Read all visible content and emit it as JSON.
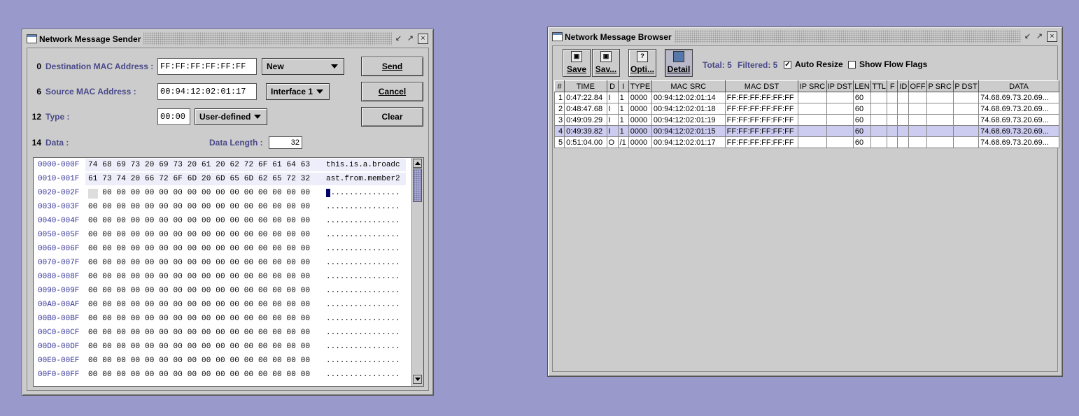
{
  "sender": {
    "title": "Network Message Sender",
    "fields": [
      {
        "num": "0",
        "label": "Destination MAC Address :",
        "value": "FF:FF:FF:FF:FF:FF",
        "combo": "New"
      },
      {
        "num": "6",
        "label": "Source MAC Address :",
        "value": "00:94:12:02:01:17",
        "combo": "Interface 1"
      },
      {
        "num": "12",
        "label": "Type :",
        "value": "00:00",
        "combo": "User-defined"
      }
    ],
    "data_num": "14",
    "data_label": "Data :",
    "data_length_label": "Data Length :",
    "data_length_value": "32",
    "buttons": {
      "send": "Send",
      "cancel": "Cancel",
      "clear": "Clear"
    },
    "hex_rows": [
      {
        "offset": "0000-000F",
        "bytes": "74 68 69 73 20 69 73 20 61 20 62 72 6F 61 64 63",
        "ascii": "this.is.a.broadc"
      },
      {
        "offset": "0010-001F",
        "bytes": "61 73 74 20 66 72 6F 6D 20 6D 65 6D 62 65 72 32",
        "ascii": "ast.from.member2"
      },
      {
        "offset": "0020-002F",
        "bytes": "00 00 00 00 00 00 00 00 00 00 00 00 00 00 00 00",
        "ascii": "................"
      },
      {
        "offset": "0030-003F",
        "bytes": "00 00 00 00 00 00 00 00 00 00 00 00 00 00 00 00",
        "ascii": "................"
      },
      {
        "offset": "0040-004F",
        "bytes": "00 00 00 00 00 00 00 00 00 00 00 00 00 00 00 00",
        "ascii": "................"
      },
      {
        "offset": "0050-005F",
        "bytes": "00 00 00 00 00 00 00 00 00 00 00 00 00 00 00 00",
        "ascii": "................"
      },
      {
        "offset": "0060-006F",
        "bytes": "00 00 00 00 00 00 00 00 00 00 00 00 00 00 00 00",
        "ascii": "................"
      },
      {
        "offset": "0070-007F",
        "bytes": "00 00 00 00 00 00 00 00 00 00 00 00 00 00 00 00",
        "ascii": "................"
      },
      {
        "offset": "0080-008F",
        "bytes": "00 00 00 00 00 00 00 00 00 00 00 00 00 00 00 00",
        "ascii": "................"
      },
      {
        "offset": "0090-009F",
        "bytes": "00 00 00 00 00 00 00 00 00 00 00 00 00 00 00 00",
        "ascii": "................"
      },
      {
        "offset": "00A0-00AF",
        "bytes": "00 00 00 00 00 00 00 00 00 00 00 00 00 00 00 00",
        "ascii": "................"
      },
      {
        "offset": "00B0-00BF",
        "bytes": "00 00 00 00 00 00 00 00 00 00 00 00 00 00 00 00",
        "ascii": "................"
      },
      {
        "offset": "00C0-00CF",
        "bytes": "00 00 00 00 00 00 00 00 00 00 00 00 00 00 00 00",
        "ascii": "................"
      },
      {
        "offset": "00D0-00DF",
        "bytes": "00 00 00 00 00 00 00 00 00 00 00 00 00 00 00 00",
        "ascii": "................"
      },
      {
        "offset": "00E0-00EF",
        "bytes": "00 00 00 00 00 00 00 00 00 00 00 00 00 00 00 00",
        "ascii": "................"
      },
      {
        "offset": "00F0-00FF",
        "bytes": "00 00 00 00 00 00 00 00 00 00 00 00 00 00 00 00",
        "ascii": "................"
      }
    ]
  },
  "browser": {
    "title": "Network Message Browser",
    "toolbar": [
      {
        "label": "Save",
        "icon": "save-icon"
      },
      {
        "label": "Sav...",
        "icon": "save-as-icon"
      },
      {
        "label": "Opti...",
        "icon": "options-icon"
      },
      {
        "label": "Detail",
        "icon": "detail-icon"
      }
    ],
    "total_text": "Total: 5",
    "filtered_text": "Filtered: 5",
    "auto_resize": {
      "label": "Auto Resize",
      "checked": true
    },
    "show_flow_flags": {
      "label": "Show Flow Flags",
      "checked": false
    },
    "columns": [
      "#",
      "TIME",
      "D",
      "I",
      "TYPE",
      "MAC SRC",
      "MAC DST",
      "IP SRC",
      "IP DST",
      "LEN",
      "TTL",
      "F",
      "ID",
      "OFF",
      "P SRC",
      "P DST",
      "DATA"
    ],
    "rows": [
      [
        "1",
        "0:47:22.84",
        "I",
        "1",
        "0000",
        "00:94:12:02:01:14",
        "FF:FF:FF:FF:FF:FF",
        "",
        "",
        "60",
        "",
        "",
        "",
        "",
        "",
        "",
        "74.68.69.73.20.69..."
      ],
      [
        "2",
        "0:48:47.68",
        "I",
        "1",
        "0000",
        "00:94:12:02:01:18",
        "FF:FF:FF:FF:FF:FF",
        "",
        "",
        "60",
        "",
        "",
        "",
        "",
        "",
        "",
        "74.68.69.73.20.69..."
      ],
      [
        "3",
        "0:49:09.29",
        "I",
        "1",
        "0000",
        "00:94:12:02:01:19",
        "FF:FF:FF:FF:FF:FF",
        "",
        "",
        "60",
        "",
        "",
        "",
        "",
        "",
        "",
        "74.68.69.73.20.69..."
      ],
      [
        "4",
        "0:49:39.82",
        "I",
        "1",
        "0000",
        "00:94:12:02:01:15",
        "FF:FF:FF:FF:FF:FF",
        "",
        "",
        "60",
        "",
        "",
        "",
        "",
        "",
        "",
        "74.68.69.73.20.69..."
      ],
      [
        "5",
        "0:51:04.00",
        "O",
        "/1",
        "0000",
        "00:94:12:02:01:17",
        "FF:FF:FF:FF:FF:FF",
        "",
        "",
        "60",
        "",
        "",
        "",
        "",
        "",
        "",
        "74.68.69.73.20.69..."
      ]
    ],
    "selected_row": 3
  },
  "colors": {
    "desktop": "#9999cc",
    "panel": "#cccccc",
    "label_blue": "#4a4a8a",
    "selected_row": "#ccccf0"
  }
}
